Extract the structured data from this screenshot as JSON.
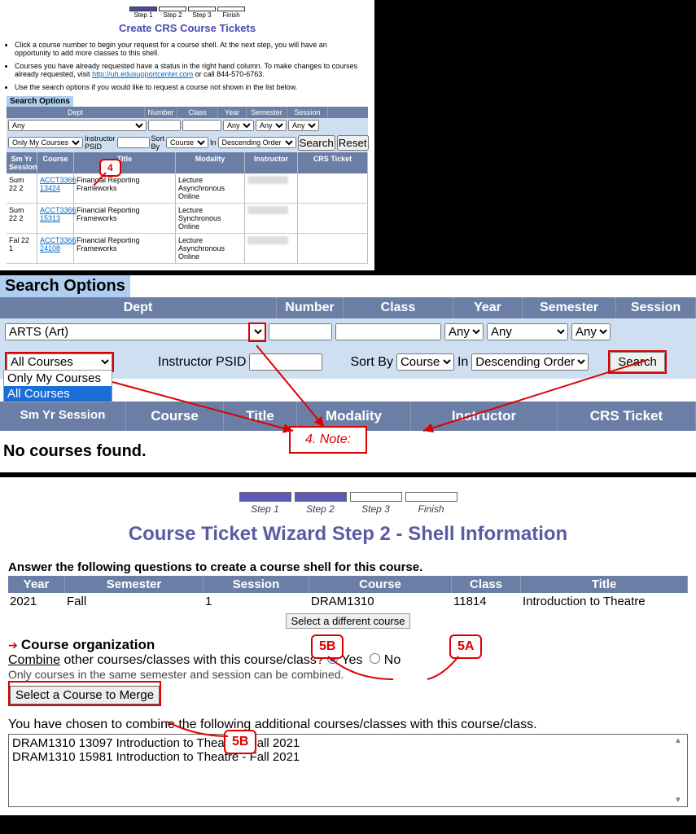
{
  "panel1": {
    "steps": [
      "Step 1",
      "Step 2",
      "Step 3",
      "Finish"
    ],
    "title": "Create CRS Course Tickets",
    "bullets": {
      "b1": "Click a course number to begin your request for a course shell. At the next step, you will have an opportunity to add more classes to this shell.",
      "b2a": "Courses you have already requested have a status in the right hand column. To make changes to courses already requested, visit ",
      "b2link": "http://uh.edusupportcenter.com",
      "b2b": " or call 844-570-6763.",
      "b3": "Use the search options if you would like to request a course not shown in the list below."
    },
    "so_label": "Search Options",
    "headers": [
      "Dept",
      "Number",
      "Class",
      "Year",
      "Semester",
      "Session"
    ],
    "row1": {
      "dept": "Any",
      "year": "Any",
      "semester": "Any",
      "session": "Any"
    },
    "row2": {
      "scope": "Only My Courses",
      "psid_label": "Instructor PSID",
      "sortby_label": "Sort By",
      "sortby": "Course",
      "in_label": "In",
      "order": "Descending Order",
      "search": "Search",
      "reset": "Reset"
    },
    "res_headers": [
      "Sm Yr Session",
      "Course",
      "Title",
      "Modality",
      "Instructor",
      "CRS Ticket"
    ],
    "rows": [
      {
        "sess": "Sum 22 2",
        "course": "ACCT3366 13424",
        "title": "Financial Reporting Frameworks",
        "mod": "Lecture Asynchronous Online"
      },
      {
        "sess": "Sum 22 2",
        "course": "ACCT3366 15313",
        "title": "Financial Reporting Frameworks",
        "mod": "Lecture Synchronous Online"
      },
      {
        "sess": "Fal 22 1",
        "course": "ACCT3366 24108",
        "title": "Financial Reporting Frameworks",
        "mod": "Lecture Asynchronous Online"
      }
    ],
    "callout": "4"
  },
  "panel2": {
    "so_label": "Search Options",
    "headers": [
      "Dept",
      "Number",
      "Class",
      "Year",
      "Semester",
      "Session"
    ],
    "row1": {
      "dept": "ARTS (Art)",
      "year": "Any",
      "semester": "Any",
      "session": "Any"
    },
    "row2": {
      "scope": "All Courses",
      "psid_label": "Instructor PSID",
      "sortby_label": "Sort By",
      "sortby": "Course",
      "in_label": "In",
      "order": "Descending Order",
      "search": "Search"
    },
    "dropdown": {
      "opt1": "Only My Courses",
      "opt2": "All Courses"
    },
    "res_headers": {
      "h0": "Sm Yr Session",
      "h1": "Course",
      "h2": "Title",
      "h3": "Modality",
      "h4": "Instructor",
      "h5": "CRS Ticket"
    },
    "no_courses": "No courses found.",
    "note": "4. Note:"
  },
  "panel3": {
    "steps": [
      "Step 1",
      "Step 2",
      "Step 3",
      "Finish"
    ],
    "title": "Course Ticket Wizard Step 2 - Shell Information",
    "question": "Answer the following questions to create a course shell for this course.",
    "headers": [
      "Year",
      "Semester",
      "Session",
      "Course",
      "Class",
      "Title"
    ],
    "row": {
      "year": "2021",
      "semester": "Fall",
      "session": "1",
      "course": "DRAM1310",
      "cls": "11814",
      "title": "Introduction to Theatre"
    },
    "select_diff": "Select a different course",
    "org_title": "Course organization",
    "combine_u": "Combine",
    "combine_rest": " other courses/classes with this course/class? ",
    "yes": "Yes",
    "no": "No",
    "hint": "Only courses in the same semester and session can be combined.",
    "merge_btn": "Select a Course to Merge",
    "chosen": "You have chosen to combine the following additional courses/classes with this course/class.",
    "merge1": "DRAM1310 13097 Introduction to Theatre - Fall 2021",
    "merge2": "DRAM1310 15981 Introduction to Theatre - Fall 2021",
    "callouts": {
      "c5a": "5A",
      "c5b": "5B"
    }
  }
}
